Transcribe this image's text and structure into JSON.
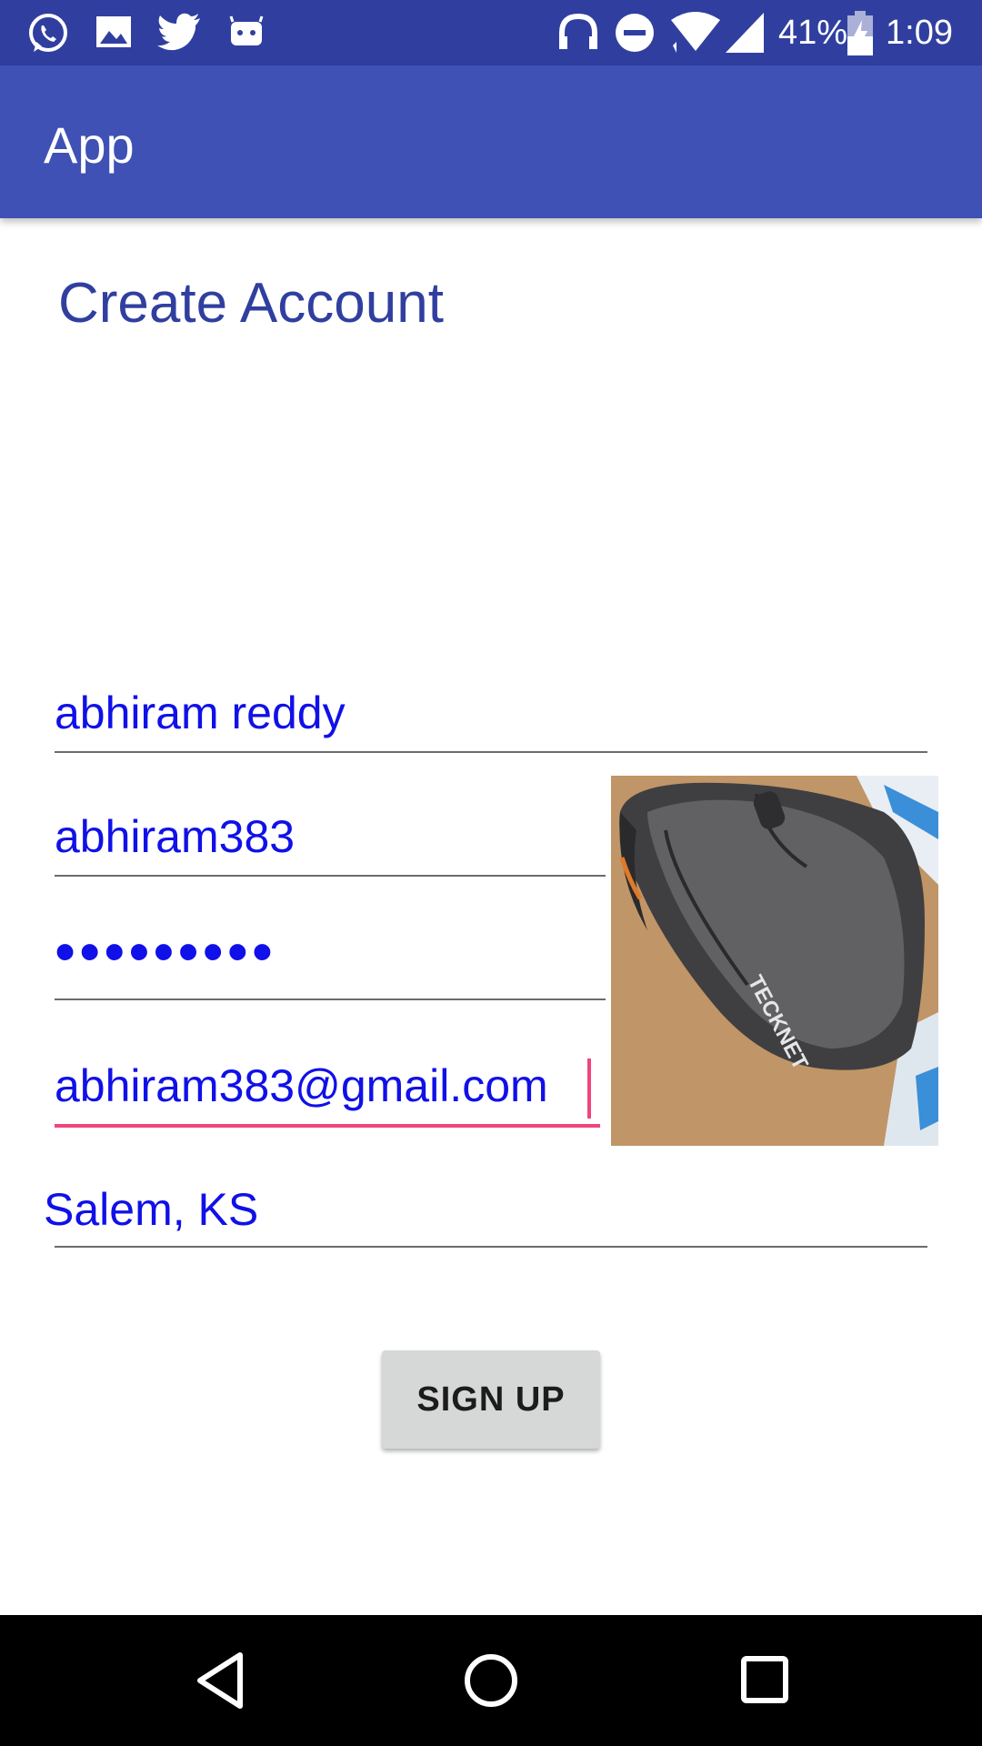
{
  "status_bar": {
    "notification_icons": [
      "whatsapp-icon",
      "image-icon",
      "twitter-icon",
      "android-icon"
    ],
    "system_icons": [
      "headphones-icon",
      "do-not-disturb-icon",
      "wifi-icon",
      "signal-icon",
      "battery-charging-icon"
    ],
    "battery_percent": "41%",
    "time": "1:09"
  },
  "app_bar": {
    "title": "App"
  },
  "form": {
    "heading": "Create Account",
    "name_value": "abhiram reddy",
    "username_value": "abhiram383",
    "password_value": "•••••••••",
    "email_value": "abhiram383@gmail.com",
    "location_value": "Salem, KS",
    "signup_label": "SIGN UP"
  },
  "nav_bar": {
    "buttons": [
      "back-icon",
      "home-icon",
      "recents-icon"
    ]
  },
  "colors": {
    "status_bar": "#303f9f",
    "app_bar": "#3f51b5",
    "heading_text": "#303f9f",
    "field_text": "#1010e8",
    "focus_accent": "#f0457a",
    "button_bg": "#d6d7d7"
  }
}
